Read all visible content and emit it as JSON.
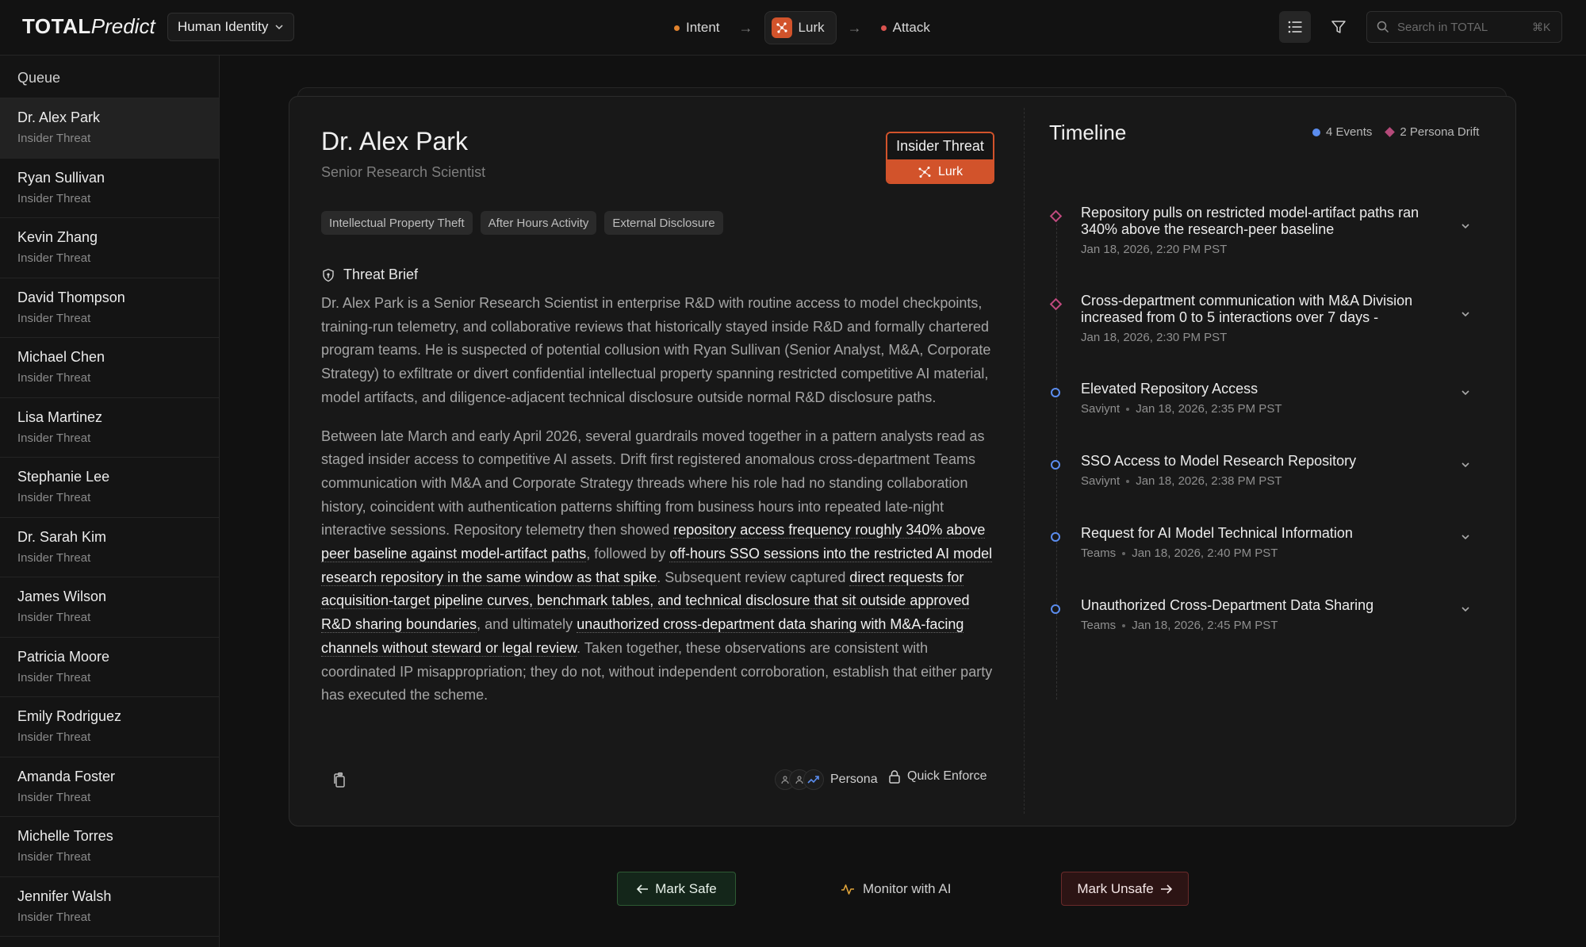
{
  "header": {
    "brand_bold": "TOTAL",
    "brand_italic": "Predict",
    "identity_selector": "Human Identity",
    "stages": [
      "Intent",
      "Lurk",
      "Attack"
    ],
    "search_placeholder": "Search in TOTAL",
    "search_shortcut": "⌘K"
  },
  "sidebar": {
    "title": "Queue",
    "items": [
      {
        "name": "Dr. Alex Park",
        "type": "Insider Threat"
      },
      {
        "name": "Ryan Sullivan",
        "type": "Insider Threat"
      },
      {
        "name": "Kevin Zhang",
        "type": "Insider Threat"
      },
      {
        "name": "David Thompson",
        "type": "Insider Threat"
      },
      {
        "name": "Michael Chen",
        "type": "Insider Threat"
      },
      {
        "name": "Lisa Martinez",
        "type": "Insider Threat"
      },
      {
        "name": "Stephanie Lee",
        "type": "Insider Threat"
      },
      {
        "name": "Dr. Sarah Kim",
        "type": "Insider Threat"
      },
      {
        "name": "James Wilson",
        "type": "Insider Threat"
      },
      {
        "name": "Patricia Moore",
        "type": "Insider Threat"
      },
      {
        "name": "Emily Rodriguez",
        "type": "Insider Threat"
      },
      {
        "name": "Amanda Foster",
        "type": "Insider Threat"
      },
      {
        "name": "Michelle Torres",
        "type": "Insider Threat"
      },
      {
        "name": "Jennifer Walsh",
        "type": "Insider Threat"
      }
    ]
  },
  "profile": {
    "name": "Dr. Alex Park",
    "role": "Senior Research Scientist",
    "threat_type": "Insider Threat",
    "threat_stage": "Lurk",
    "tags": [
      "Intellectual Property Theft",
      "After Hours Activity",
      "External Disclosure"
    ],
    "brief_title": "Threat Brief",
    "brief_p1": "Dr. Alex Park is a Senior Research Scientist in enterprise R&D with routine access to model checkpoints, training-run telemetry, and collaborative reviews that historically stayed inside R&D and formally chartered program teams. He is suspected of potential collusion with Ryan Sullivan (Senior Analyst, M&A, Corporate Strategy) to exfiltrate or divert confidential intellectual property spanning restricted competitive AI material, model artifacts, and diligence-adjacent technical disclosure outside normal R&D disclosure paths.",
    "brief_p2": {
      "s1": "Between late March and early April 2026, several guardrails moved together in a pattern analysts read as staged insider access to competitive AI assets. Drift first registered anomalous cross-department Teams communication with M&A and Corporate Strategy threads where his role had no standing collaboration history, coincident with authentication patterns shifting from business hours into repeated late-night interactive sessions. Repository telemetry then showed ",
      "h1": "repository access frequency roughly 340% above peer baseline against model-artifact paths",
      "s2": ", followed by ",
      "h2": "off-hours SSO sessions into the restricted AI model research repository in the same window as that spike",
      "s3": ". Subsequent review captured ",
      "h3": "direct requests for acquisition-target pipeline curves, benchmark tables, and technical disclosure that sit outside approved R&D sharing boundaries",
      "s4": ", and ultimately ",
      "h4": "unauthorized cross-department data sharing with M&A-facing channels without steward or legal review",
      "s5": ". Taken together, these observations are consistent with coordinated IP misappropriation; they do not, without independent corroboration, establish that either party has executed the scheme."
    },
    "persona_label": "Persona",
    "enforce_label": "Quick Enforce"
  },
  "timeline": {
    "title": "Timeline",
    "events_count": "4 Events",
    "drift_count": "2 Persona Drift",
    "events": [
      {
        "kind": "drift",
        "title": "Repository pulls on restricted model-artifact paths ran 340% above the research-peer baseline",
        "source": "",
        "time": "Jan 18, 2026, 2:20 PM PST"
      },
      {
        "kind": "drift",
        "title": "Cross-department communication with M&A Division increased from 0 to 5 interactions over 7 days -",
        "source": "",
        "time": "Jan 18, 2026, 2:30 PM PST"
      },
      {
        "kind": "event",
        "title": "Elevated Repository Access",
        "source": "Saviynt",
        "time": "Jan 18, 2026, 2:35 PM PST"
      },
      {
        "kind": "event",
        "title": "SSO Access to Model Research Repository",
        "source": "Saviynt",
        "time": "Jan 18, 2026, 2:38 PM PST"
      },
      {
        "kind": "event",
        "title": "Request for AI Model Technical Information",
        "source": "Teams",
        "time": "Jan 18, 2026, 2:40 PM PST"
      },
      {
        "kind": "event",
        "title": "Unauthorized Cross-Department Data Sharing",
        "source": "Teams",
        "time": "Jan 18, 2026, 2:45 PM PST"
      }
    ]
  },
  "actions": {
    "mark_safe": "Mark Safe",
    "monitor": "Monitor with AI",
    "mark_unsafe": "Mark Unsafe"
  },
  "colors": {
    "accent": "#d2532b",
    "event_blue": "#5b8def",
    "drift_magenta": "#c14a7f",
    "safe_green": "#14261a",
    "unsafe_red": "#2c1414"
  }
}
